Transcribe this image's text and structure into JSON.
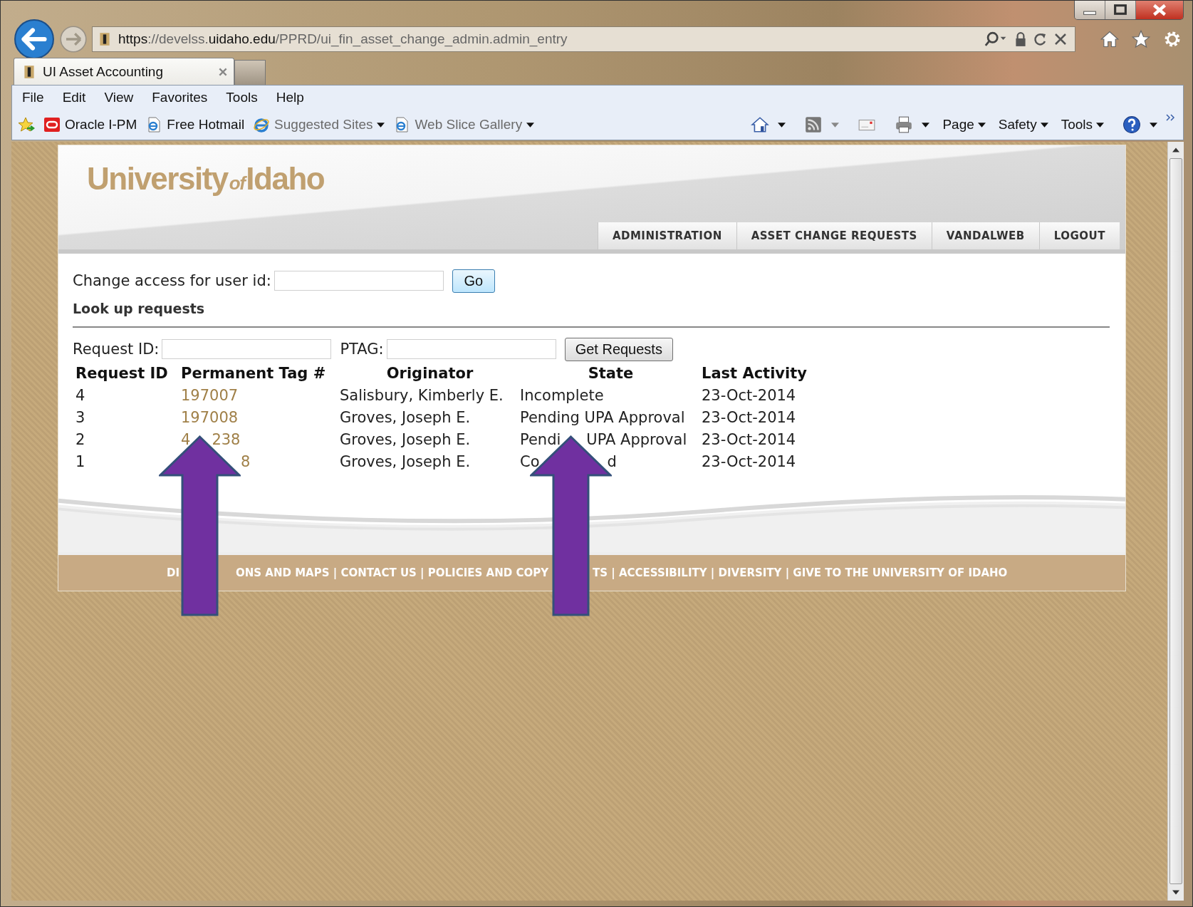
{
  "address_bar": {
    "url_parts": [
      {
        "text": "https",
        "dim": false
      },
      {
        "text": "://develss.",
        "dim": true
      },
      {
        "text": "uidaho.edu",
        "dim": false
      },
      {
        "text": "/PPRD/ui_fin_asset_change_admin.admin_entry",
        "dim": true
      }
    ]
  },
  "tabs": [
    {
      "label": "UI Asset Accounting",
      "selected": true
    }
  ],
  "menu": [
    "File",
    "Edit",
    "View",
    "Favorites",
    "Tools",
    "Help"
  ],
  "favorites": [
    {
      "label": "Oracle I-PM",
      "kind": "oracle",
      "dropdown": false,
      "disabled": false
    },
    {
      "label": "Free Hotmail",
      "kind": "page",
      "dropdown": false,
      "disabled": false
    },
    {
      "label": "Suggested Sites",
      "kind": "ie",
      "dropdown": true,
      "disabled": true
    },
    {
      "label": "Web Slice Gallery",
      "kind": "page",
      "dropdown": true,
      "disabled": true
    }
  ],
  "command_bar": [
    {
      "kind": "home"
    },
    {
      "kind": "feeds"
    },
    {
      "kind": "mail"
    },
    {
      "kind": "print"
    },
    {
      "kind": "menu",
      "label": "Page"
    },
    {
      "kind": "menu",
      "label": "Safety"
    },
    {
      "kind": "menu",
      "label": "Tools"
    },
    {
      "kind": "help"
    }
  ],
  "site": {
    "logo": {
      "first": "University",
      "middle": "of",
      "last": "Idaho"
    },
    "nav": [
      "ADMINISTRATION",
      "ASSET CHANGE REQUESTS",
      "VANDALWEB",
      "LOGOUT"
    ]
  },
  "access_form": {
    "label": "Change access for user id:",
    "button": "Go"
  },
  "lookup": {
    "heading": "Look up requests",
    "fields": [
      {
        "label": "Request ID:"
      },
      {
        "label": "PTAG:"
      }
    ],
    "button": "Get Requests"
  },
  "table": {
    "columns": [
      "Request ID",
      "Permanent Tag #",
      "Originator",
      "State",
      "Last Activity"
    ],
    "rows": [
      {
        "request_id": "4",
        "tag": {
          "parts": [
            "197007"
          ],
          "covered_start": false
        },
        "originator": "Salisbury, Kimberly E.",
        "state": {
          "parts": [
            "Incomplete"
          ]
        },
        "last_activity": "23-Oct-2014"
      },
      {
        "request_id": "3",
        "tag": {
          "parts": [
            "197008"
          ],
          "covered_start": false
        },
        "originator": "Groves, Joseph E.",
        "state": {
          "parts": [
            "Pending UPA Approval"
          ]
        },
        "last_activity": "23-Oct-2014"
      },
      {
        "request_id": "2",
        "tag": {
          "parts": [
            "4",
            "238"
          ],
          "covered_start": false
        },
        "originator": "Groves, Joseph E.",
        "state": {
          "parts": [
            "Pendi",
            "UPA Approval"
          ]
        },
        "last_activity": "23-Oct-2014"
      },
      {
        "request_id": "1",
        "tag": {
          "parts": [
            "8"
          ],
          "covered_start": true
        },
        "originator": "Groves, Joseph E.",
        "state": {
          "parts": [
            "Co",
            "d"
          ]
        },
        "last_activity": "23-Oct-2014"
      }
    ]
  },
  "footer": {
    "parts": [
      "DI",
      "ONS AND MAPS | CONTACT US | POLICIES AND COPY",
      "TS | ACCESSIBILITY | DIVERSITY | GIVE TO THE UNIVERSITY OF IDAHO"
    ]
  }
}
